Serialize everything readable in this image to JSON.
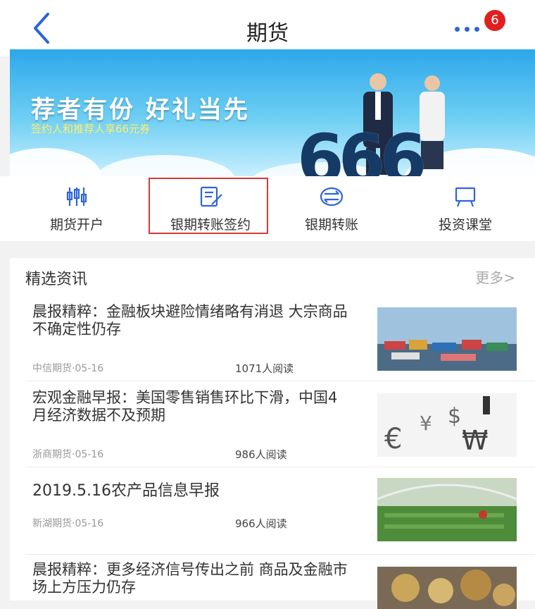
{
  "header": {
    "title": "期货",
    "badge": "6"
  },
  "banner": {
    "headline": "荐者有份 好礼当先",
    "subline": "签约人和推荐人享66元券",
    "number": "666"
  },
  "actions": [
    {
      "label": "期货开户",
      "icon": "bars-sliders-icon"
    },
    {
      "label": "银期转账签约",
      "icon": "sign-document-icon"
    },
    {
      "label": "银期转账",
      "icon": "transfer-icon"
    },
    {
      "label": "投资课堂",
      "icon": "classroom-board-icon"
    }
  ],
  "news": {
    "title": "精选资讯",
    "more": "更多>",
    "items": [
      {
        "headline": "晨报精粹：金融板块避险情绪略有消退 大宗商品不确定性仍存",
        "source": "中信期货·05-16",
        "reads": "1071人阅读"
      },
      {
        "headline": "宏观金融早报：美国零售销售环比下滑，中国4月经济数据不及预期",
        "source": "浙商期货·05-16",
        "reads": "986人阅读"
      },
      {
        "headline": "2019.5.16农产品信息早报",
        "source": "新湖期货·05-16",
        "reads": "966人阅读"
      },
      {
        "headline": "晨报精粹：更多经济信号传出之前 商品及金融市场上方压力仍存",
        "source": "",
        "reads": ""
      }
    ]
  },
  "colors": {
    "accent": "#2f64d8",
    "highlight": "#d23a34",
    "badge": "#e02020"
  }
}
